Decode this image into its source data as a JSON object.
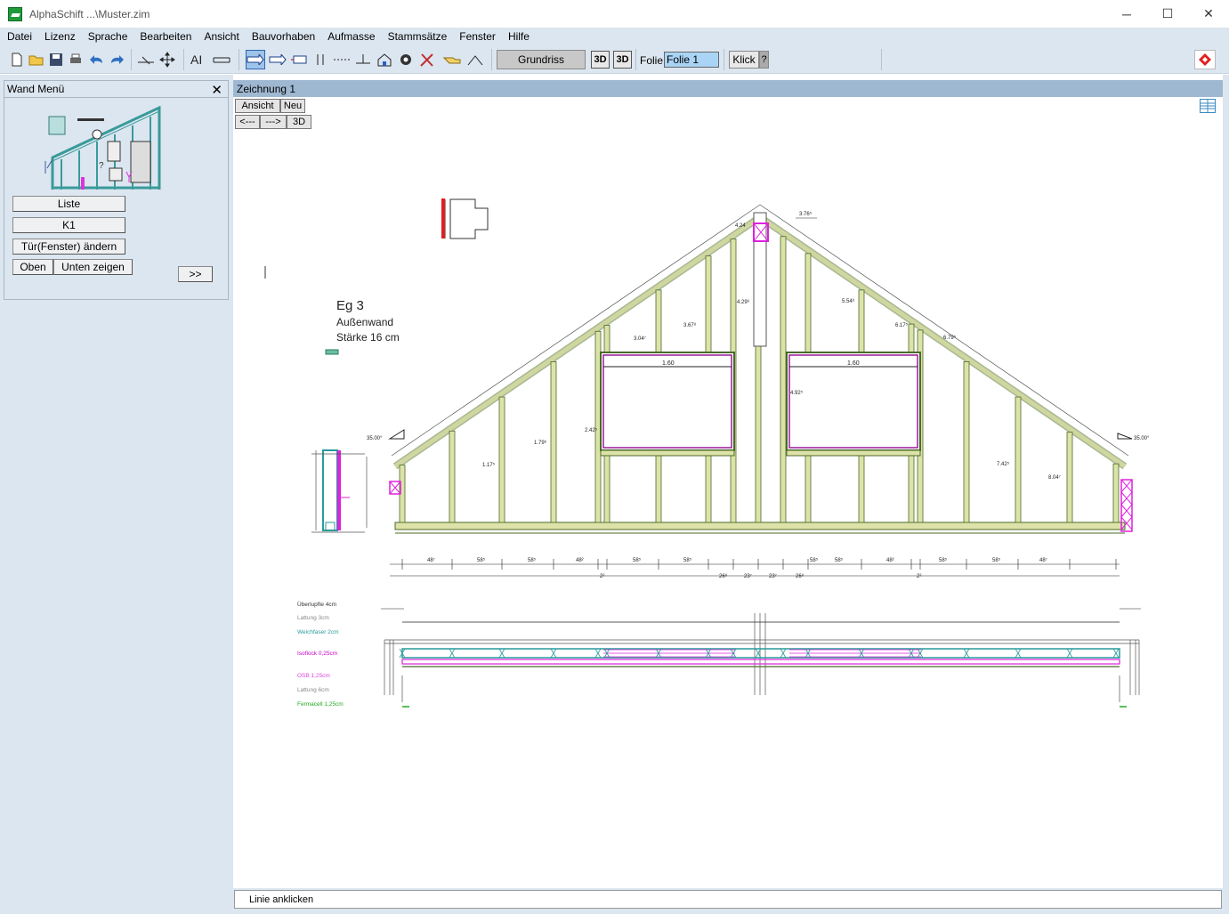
{
  "window": {
    "title": "AlphaSchift ...\\Muster.zim",
    "minimize": "─",
    "maximize": "☐",
    "close": "✕"
  },
  "menu": [
    "Datei",
    "Lizenz",
    "Sprache",
    "Bearbeiten",
    "Ansicht",
    "Bauvorhaben",
    "Aufmasse",
    "Stammsätze",
    "Fenster",
    "Hilfe"
  ],
  "toolbar": {
    "grundriss": "Grundriss",
    "btn_3d_a": "3D",
    "btn_3d_b": "3D",
    "folie_label": "Folie:",
    "folie_value": "Folie 1",
    "klick": "Klick",
    "help": "?"
  },
  "wand_menu": {
    "title": "Wand Menü",
    "close": "✕",
    "buttons": {
      "liste": "Liste",
      "k1": "K1",
      "tuer": "Tür(Fenster) ändern",
      "oben": "Oben",
      "unten": "Unten zeigen",
      "more": ">>"
    }
  },
  "drawing": {
    "tab_title": "Zeichnung 1",
    "ansicht": "Ansicht",
    "neu": "Neu",
    "back": "<---",
    "fwd": "--->",
    "btn3d": "3D",
    "label_title": "Eg  3",
    "label_type": "Außenwand",
    "label_thickness": "Stärke  16 cm",
    "window_width_left": "1.60",
    "window_width_right": "1.60",
    "angle_left": "35.00°",
    "angle_right": "35.00°",
    "layers": [
      {
        "name": "Überlupfte 4cm",
        "color": "#333333"
      },
      {
        "name": "Lattung 3cm",
        "color": "#888888"
      },
      {
        "name": "Weichfaser 2cm",
        "color": "#2a9a9a"
      },
      {
        "name": "Isoflock 0,25cm",
        "color": "#cc00cc"
      },
      {
        "name": "OSB 1,25cm",
        "color": "#dd44dd"
      },
      {
        "name": "Lattung 6cm",
        "color": "#888888"
      },
      {
        "name": "Fermacell 1,25cm",
        "color": "#22aa22"
      }
    ],
    "dims_bottom": [
      "48⁷",
      "58⁵",
      "58⁵",
      "48²",
      "58⁵",
      "58⁵",
      "58⁵",
      "58⁵",
      "48²",
      "58⁵",
      "58⁵",
      "48⁷"
    ],
    "dims_bottom_sub": [
      "2²",
      "26⁸",
      "23⁷",
      "23⁷",
      "26⁸",
      "2²"
    ],
    "dims_left_vertical": [
      "1.17⁵",
      "1.79⁶",
      "2.42⁵",
      "3.04⁷",
      "3.67⁸",
      "4.29⁶"
    ],
    "dims_right_vertical": [
      "8.04⁷",
      "7.42⁵",
      "6.79⁵",
      "6.17⁵",
      "5.54⁸",
      "4.92⁵"
    ],
    "top_dims": [
      "4.24",
      "3.76⁵"
    ]
  },
  "status": "Linie anklicken"
}
